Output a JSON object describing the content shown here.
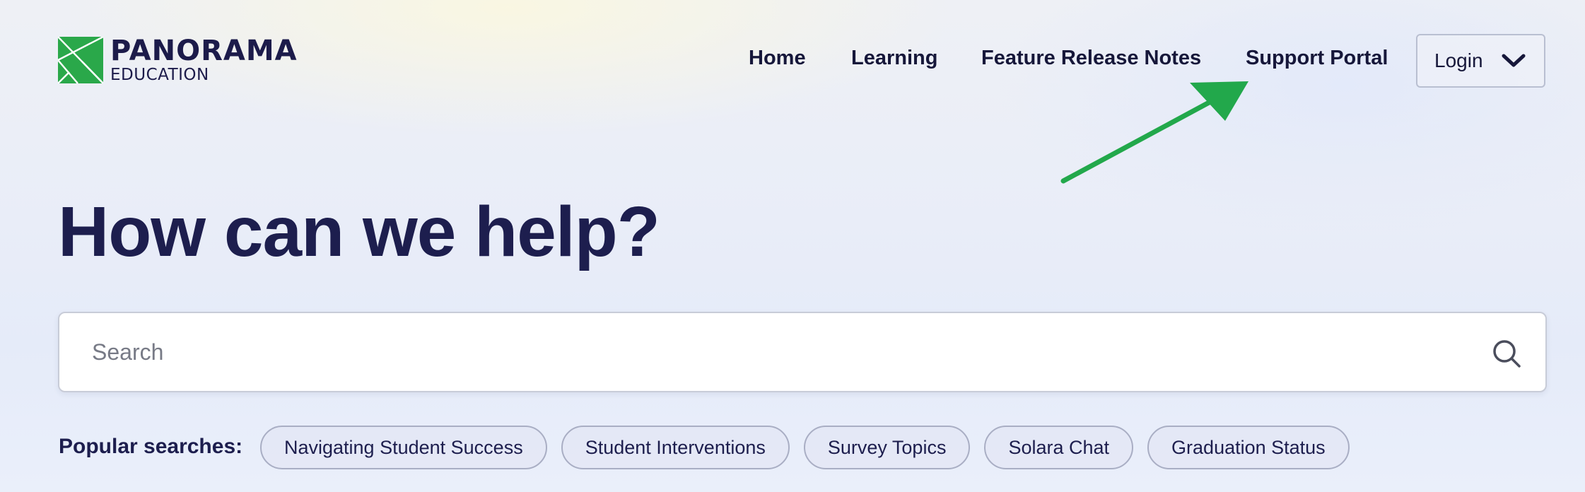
{
  "brand": {
    "name": "PANORAMA",
    "sub": "EDUCATION",
    "green": "#2aa84a"
  },
  "nav": {
    "home": "Home",
    "learning": "Learning",
    "release_notes": "Feature Release Notes",
    "support": "Support Portal",
    "login": "Login"
  },
  "hero": {
    "title": "How can we help?"
  },
  "search": {
    "placeholder": "Search"
  },
  "popular": {
    "label": "Popular searches:",
    "chips": [
      "Navigating Student Success",
      "Student Interventions",
      "Survey Topics",
      "Solara Chat",
      "Graduation Status"
    ]
  },
  "annotation": {
    "arrow_color": "#22a84b"
  },
  "icons": [
    "panorama-logo-icon",
    "chevron-down-icon",
    "search-icon",
    "arrow-annotation-icon"
  ]
}
